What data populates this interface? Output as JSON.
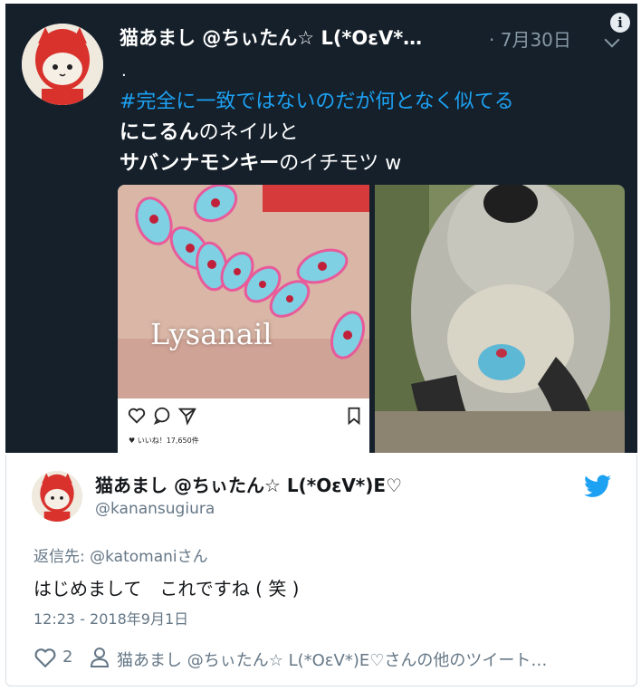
{
  "embedded_tweet": {
    "author": "猫あまし @ちぃたん☆ L(*OεV*…",
    "date": "· 7月30日",
    "dot": ".",
    "hashtag": "#完全に一致ではないのだが何となく似てる",
    "line1_bold": "にこるん",
    "line1_rest": "のネイルと",
    "line2_bold": "サバンナモンキー",
    "line2_rest": "のイチモツ w",
    "image_left": {
      "watermark": "Lysanail",
      "likes_text": "♥ いいね！17,650件",
      "icons": [
        "heart-icon",
        "comment-icon",
        "share-icon",
        "bookmark-icon"
      ]
    },
    "image_right": {
      "icon": "monkey-photo"
    }
  },
  "reply_tweet": {
    "author": "猫あまし @ちぃたん☆ L(*OεV*)E♡",
    "handle": "@kanansugiura",
    "reply_prefix": "返信先: ",
    "reply_mention": "@katomani",
    "reply_suffix": "さん",
    "text": "はじめまして　これですね ( 笑 )",
    "timestamp": "12:23 - 2018年9月1日",
    "like_count": "2",
    "more_link": "猫あまし @ちぃたん☆ L(*OεV*)E♡さんの他のツイート…"
  },
  "colors": {
    "dark_bg": "#15202b",
    "hashtag": "#1da1f2",
    "twitter_blue": "#1da1f2",
    "muted": "#657786"
  }
}
